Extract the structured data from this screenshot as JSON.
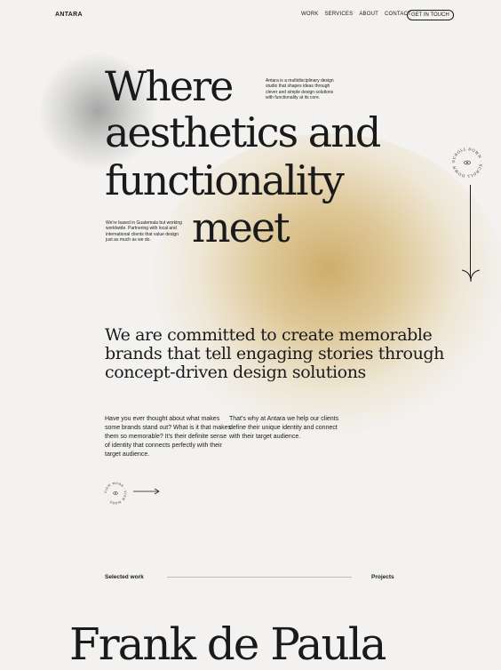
{
  "header": {
    "logo": "ANTARA",
    "nav": [
      "WORK",
      "SERVICES",
      "ABOUT",
      "CONTACT"
    ],
    "cta": "GET IN TOUCH"
  },
  "hero": {
    "lines": [
      "Where",
      "aesthetics and",
      "functionality",
      "meet"
    ],
    "intro": "Antara is a multidisciplinary design studio that shapes ideas through clever and simple design solutions with functionality at its core.",
    "based": "We're based in Guatemala but working worldwide. Partnering with local and international clients that value design just as much as we do."
  },
  "scroll": {
    "badge_text": "SCROLL DOWN · SCROLL DOWN ·"
  },
  "commitment": {
    "heading": "We are committed to create memorable brands that tell engaging stories through concept-driven design solutions",
    "para1": "Have you ever thought about what makes some brands stand out? What is it that makes them so memorable? It's their definite sense of identity that connects perfectly with their target audience.",
    "para2": "That's why at Antara we help our clients define their unique identity and connect with their target audience.",
    "more_badge_text": "VIEW MORE · VIEW MORE ·"
  },
  "selected_work": {
    "label": "Selected work",
    "projects_label": "Projects",
    "first_project": "Frank de Paula"
  },
  "colors": {
    "background": "#f3f2f0",
    "text": "#1a1a1a",
    "accent_gold": "#cdaa64"
  }
}
